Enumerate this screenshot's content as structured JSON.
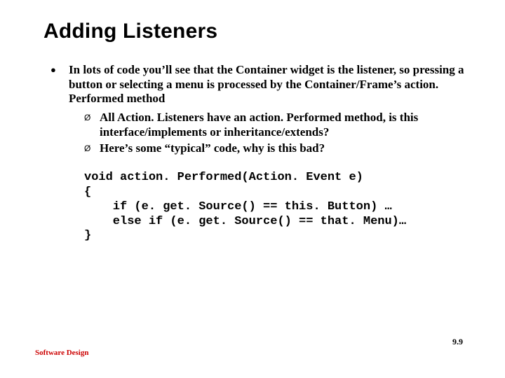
{
  "title": "Adding Listeners",
  "bullet1": {
    "marker": "●",
    "text": "In lots of code you’ll see that the Container widget is the listener, so pressing a button or selecting a menu is processed by the Container/Frame’s action. Performed method"
  },
  "sub": {
    "marker": "Ø",
    "items": [
      "All Action. Listeners have an action. Performed method, is this interface/implements or inheritance/extends?",
      "Here’s some “typical” code, why is this bad?"
    ]
  },
  "code": "void action. Performed(Action. Event e)\n{\n    if (e. get. Source() == this. Button) …\n    else if (e. get. Source() == that. Menu)…\n}",
  "footer": "Software Design",
  "pagenum": "9.9"
}
